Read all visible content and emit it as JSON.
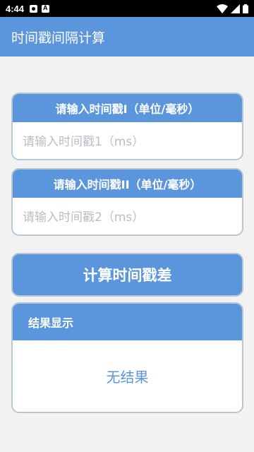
{
  "status_bar": {
    "time": "4:44",
    "icons": [
      "gmail-icon",
      "a-icon",
      "wifi-icon",
      "signal-icon",
      "battery-icon"
    ]
  },
  "app_bar": {
    "title": "时间戳间隔计算"
  },
  "timestamp1": {
    "header": "请输入时间戳I（单位/毫秒）",
    "placeholder": "请输入时间戳1（ms）",
    "value": ""
  },
  "timestamp2": {
    "header": "请输入时间戳II（单位/毫秒）",
    "placeholder": "请输入时间戳2（ms）",
    "value": ""
  },
  "calculate_button": {
    "label": "计算时间戳差"
  },
  "result": {
    "header": "结果显示",
    "text": "无结果"
  },
  "colors": {
    "primary": "#5b95dc",
    "background": "#f2f2f2",
    "border": "#b7c7d6",
    "placeholder": "#b8bec4"
  }
}
